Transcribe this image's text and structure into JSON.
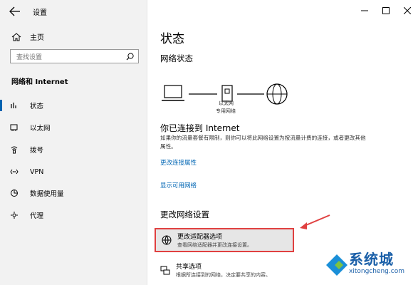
{
  "window": {
    "title": "设置"
  },
  "sidebar": {
    "home_label": "主页",
    "search_placeholder": "查找设置",
    "section": "网络和 Internet",
    "items": [
      {
        "label": "状态",
        "icon": "status-icon",
        "active": true
      },
      {
        "label": "以太网",
        "icon": "ethernet-icon"
      },
      {
        "label": "拨号",
        "icon": "dialup-icon"
      },
      {
        "label": "VPN",
        "icon": "vpn-icon"
      },
      {
        "label": "数据使用量",
        "icon": "data-usage-icon"
      },
      {
        "label": "代理",
        "icon": "proxy-icon"
      }
    ]
  },
  "main": {
    "title": "状态",
    "network_status_heading": "网络状态",
    "diagram": {
      "caption_line1": "以太网",
      "caption_line2": "专用网络"
    },
    "connected_title": "你已连接到 Internet",
    "connected_desc": "如果你的流量套餐有限制，则你可以将此网络设置为按流量计费的连接，或者更改其他属性。",
    "link_change_props": "更改连接属性",
    "link_show_networks": "显示可用网络",
    "change_settings_heading": "更改网络设置",
    "options": [
      {
        "title": "更改适配器选项",
        "desc": "查看网络适配器并更改连接设置。",
        "icon": "adapter-icon",
        "highlight": true
      },
      {
        "title": "共享选项",
        "desc": "根据所连接到的网络，决定要共享的内容。",
        "icon": "sharing-icon"
      }
    ]
  },
  "watermark": {
    "name": "系统城",
    "url": "xitongcheng.com"
  },
  "colors": {
    "accent": "#0063b1",
    "link": "#0066b4",
    "highlight_border": "#e04040"
  }
}
